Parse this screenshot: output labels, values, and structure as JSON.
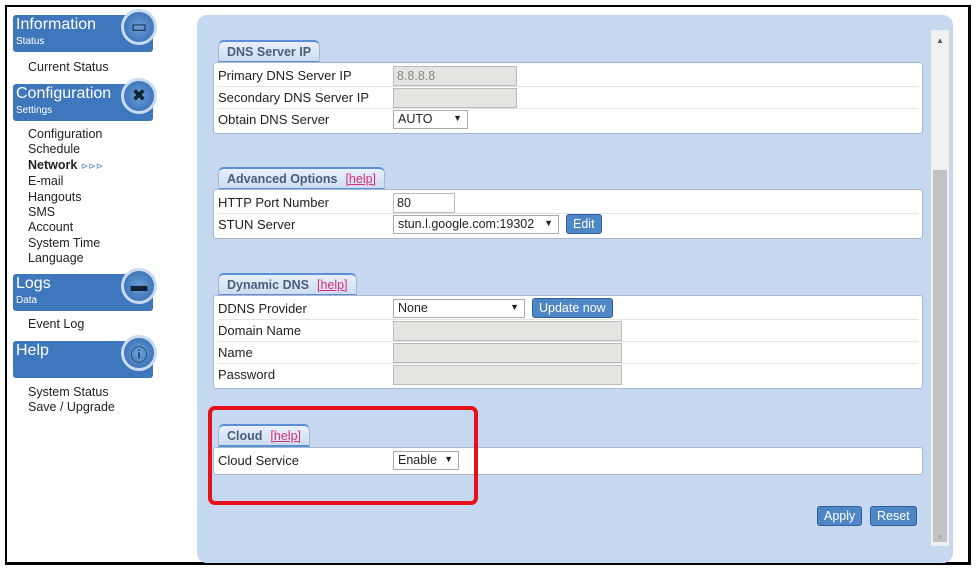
{
  "sidebar": {
    "groups": [
      {
        "title": "Information",
        "subtitle": "Status",
        "icon": "monitor-icon",
        "items": [
          "Current Status"
        ]
      },
      {
        "title": "Configuration",
        "subtitle": "Settings",
        "icon": "tools-icon",
        "items": [
          "Configuration",
          "Schedule",
          "Network",
          "E-mail",
          "Hangouts",
          "SMS",
          "Account",
          "System Time",
          "Language"
        ]
      },
      {
        "title": "Logs",
        "subtitle": "Data",
        "icon": "folder-icon",
        "items": [
          "Event Log"
        ]
      },
      {
        "title": "Help",
        "subtitle": "",
        "icon": "info-icon",
        "items": [
          "System Status",
          "Save / Upgrade"
        ]
      }
    ],
    "active_item": "Network",
    "active_marker": "⊳⊳⊳"
  },
  "sections": {
    "dns": {
      "title": "DNS Server IP",
      "rows": [
        {
          "label": "Primary DNS Server IP",
          "value": "8.8.8.8"
        },
        {
          "label": "Secondary DNS Server IP",
          "value": ""
        },
        {
          "label": "Obtain DNS Server",
          "value": "AUTO"
        }
      ]
    },
    "advanced": {
      "title": "Advanced Options",
      "help": "[help]",
      "rows": [
        {
          "label": "HTTP Port Number",
          "value": "80"
        },
        {
          "label": "STUN Server",
          "value": "stun.l.google.com:19302",
          "button": "Edit"
        }
      ]
    },
    "ddns": {
      "title": "Dynamic DNS",
      "help": "[help]",
      "rows": [
        {
          "label": "DDNS Provider",
          "value": "None",
          "button": "Update now"
        },
        {
          "label": "Domain Name",
          "value": ""
        },
        {
          "label": "Name",
          "value": ""
        },
        {
          "label": "Password",
          "value": ""
        }
      ]
    },
    "cloud": {
      "title": "Cloud",
      "help": "[help]",
      "rows": [
        {
          "label": "Cloud Service",
          "value": "Enable"
        }
      ]
    }
  },
  "buttons": {
    "apply": "Apply",
    "reset": "Reset"
  },
  "colors": {
    "accent": "#3f77bd",
    "highlight": "#e8101a",
    "panel": "#c6d8f0"
  }
}
